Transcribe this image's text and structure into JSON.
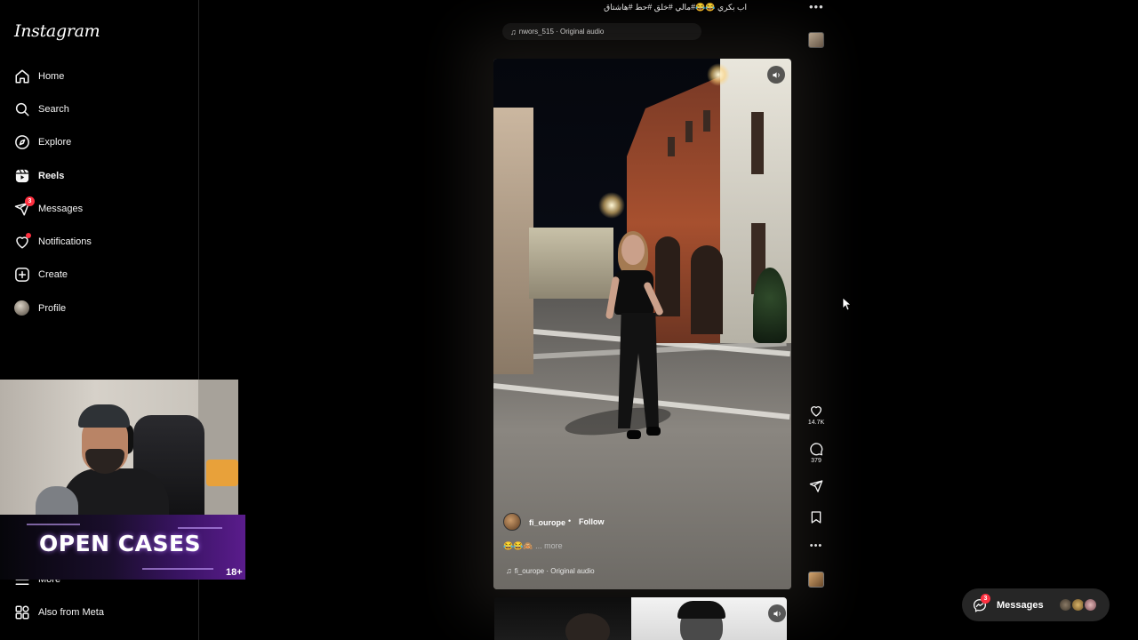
{
  "app": {
    "logo": "Instagram"
  },
  "sidebar": {
    "items": [
      {
        "label": "Home",
        "icon": "home-icon"
      },
      {
        "label": "Search",
        "icon": "search-icon"
      },
      {
        "label": "Explore",
        "icon": "compass-icon"
      },
      {
        "label": "Reels",
        "icon": "reels-icon",
        "active": true
      },
      {
        "label": "Messages",
        "icon": "send-icon",
        "badge": "3"
      },
      {
        "label": "Notifications",
        "icon": "heart-icon",
        "dot": true
      },
      {
        "label": "Create",
        "icon": "plus-square-icon"
      },
      {
        "label": "Profile",
        "icon": "avatar"
      }
    ],
    "more_label": "More",
    "also_from_meta": "Also from Meta"
  },
  "overlay": {
    "banner_text": "OPEN CASES",
    "banner_age": "18+"
  },
  "reel": {
    "top_caption": "اب بكري 😂😂#مالي #خلق #حط #هاشتاق",
    "top_audio": "nwors_515 · Original audio",
    "username": "fi_ourope",
    "follow_label": "Follow",
    "separator": "•",
    "caption_emojis": "😂😂🙈",
    "caption_more": "... more",
    "audio": "fi_ourope · Original audio",
    "likes": "14.7K",
    "comments": "379"
  },
  "messages_pill": {
    "label": "Messages",
    "badge": "3"
  },
  "colors": {
    "accent_red": "#ff3040",
    "sidebar_bg": "#000000",
    "pill_bg": "#262626"
  }
}
